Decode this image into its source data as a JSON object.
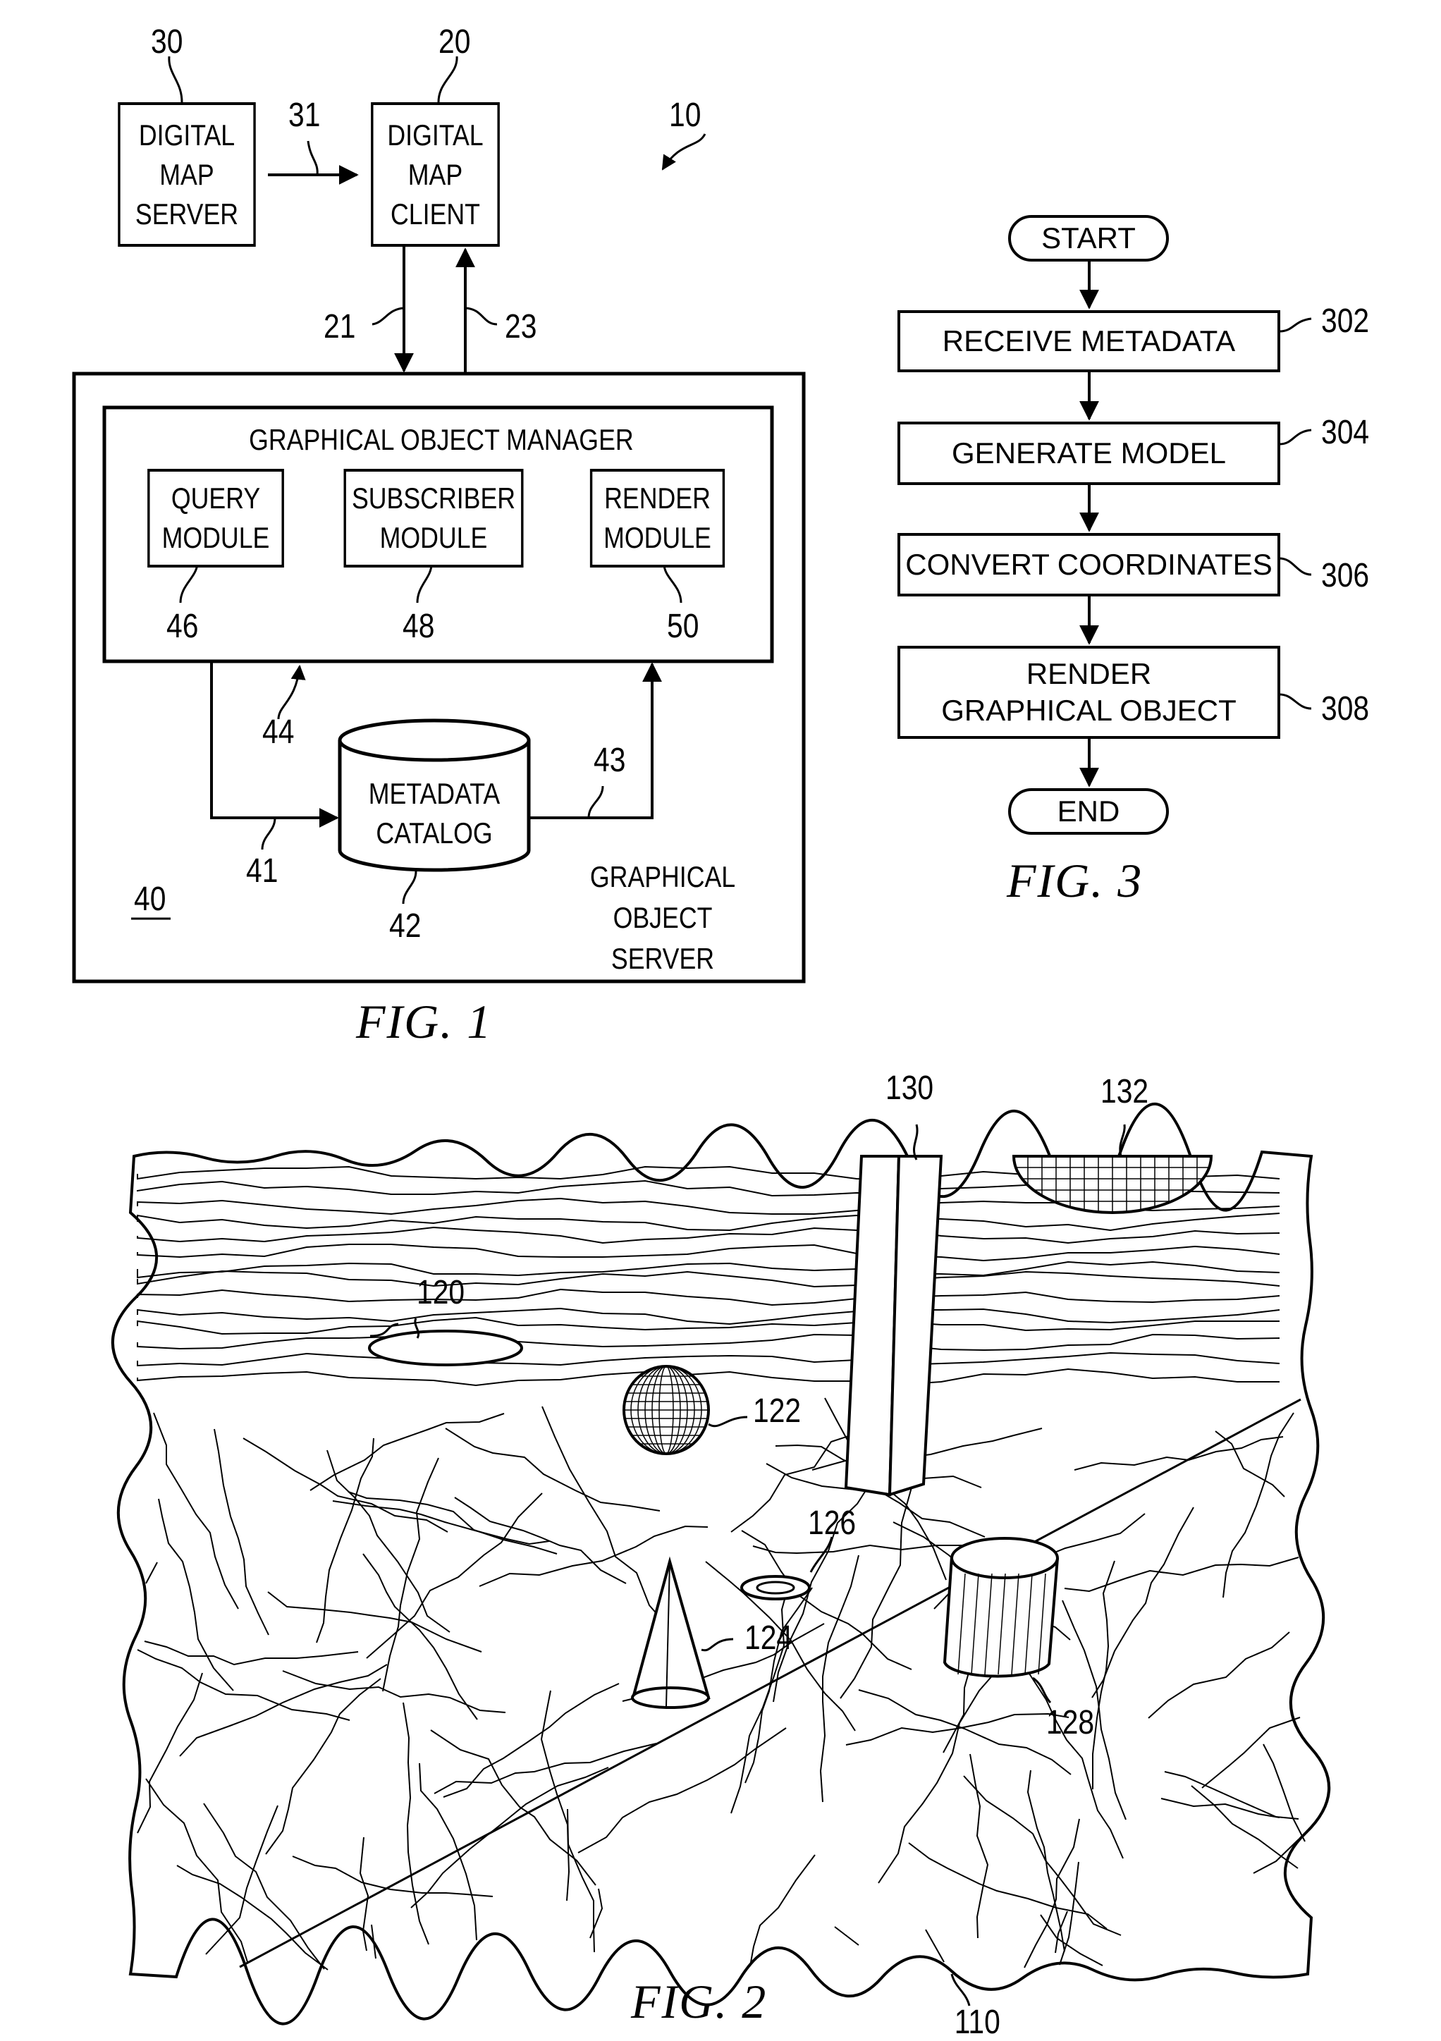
{
  "fig1": {
    "caption": "FIG. 1",
    "system_ref": "10",
    "digital_map_server": {
      "lines": [
        "DIGITAL",
        "MAP",
        "SERVER"
      ],
      "ref": "30"
    },
    "digital_map_client": {
      "lines": [
        "DIGITAL",
        "MAP",
        "CLIENT"
      ],
      "ref": "20"
    },
    "link_server_client_ref": "31",
    "link_client_down_ref": "21",
    "link_client_up_ref": "23",
    "graphical_object_server": {
      "lines": [
        "GRAPHICAL",
        "OBJECT SERVER"
      ],
      "ref": "40"
    },
    "graphical_object_manager": {
      "title": "GRAPHICAL OBJECT MANAGER",
      "ref": "44"
    },
    "modules": [
      {
        "lines": [
          "QUERY",
          "MODULE"
        ],
        "ref": "46"
      },
      {
        "lines": [
          "SUBSCRIBER",
          "MODULE"
        ],
        "ref": "48"
      },
      {
        "lines": [
          "RENDER",
          "MODULE"
        ],
        "ref": "50"
      }
    ],
    "metadata_catalog": {
      "lines": [
        "METADATA",
        "CATALOG"
      ],
      "ref": "42"
    },
    "link_to_catalog_ref": "41",
    "link_from_catalog_ref": "43"
  },
  "fig3": {
    "caption": "FIG. 3",
    "start": "START",
    "end": "END",
    "steps": [
      {
        "lines": [
          "RECEIVE METADATA"
        ],
        "ref": "302"
      },
      {
        "lines": [
          "GENERATE MODEL"
        ],
        "ref": "304"
      },
      {
        "lines": [
          "CONVERT COORDINATES"
        ],
        "ref": "306"
      },
      {
        "lines": [
          "RENDER",
          "GRAPHICAL OBJECT"
        ],
        "ref": "308"
      }
    ]
  },
  "fig2": {
    "caption": "FIG. 2",
    "terrain_ref": "110",
    "objects": [
      {
        "name": "ellipse",
        "ref": "120"
      },
      {
        "name": "sphere",
        "ref": "122"
      },
      {
        "name": "cone",
        "ref": "124"
      },
      {
        "name": "ring",
        "ref": "126"
      },
      {
        "name": "cylinder",
        "ref": "128"
      },
      {
        "name": "column",
        "ref": "130"
      },
      {
        "name": "hemisphere",
        "ref": "132"
      }
    ]
  }
}
